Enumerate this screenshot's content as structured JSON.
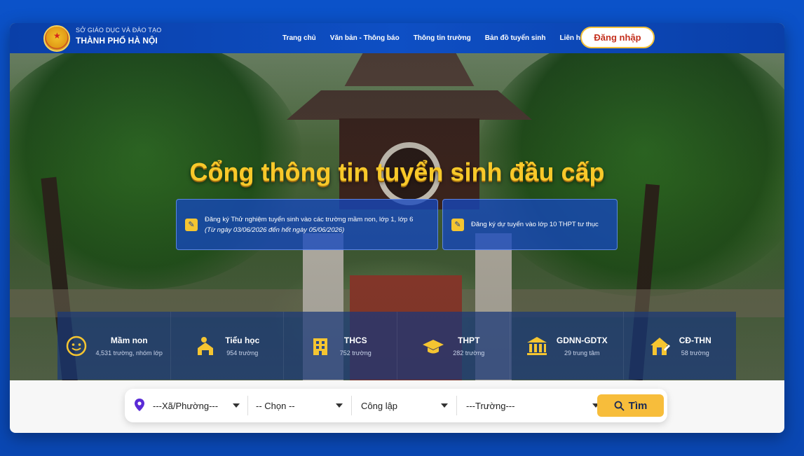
{
  "header": {
    "org_line1": "SỞ GIÁO DỤC VÀ ĐÀO TẠO",
    "org_line2": "THÀNH PHỐ HÀ NỘI",
    "nav": [
      "Trang chủ",
      "Văn bản - Thông báo",
      "Thông tin trường",
      "Bản đồ tuyển sinh",
      "Liên hệ"
    ],
    "login_label": "Đăng nhập"
  },
  "hero": {
    "title": "Cổng thông tin tuyển sinh đầu cấp"
  },
  "registration": [
    {
      "line1": "Đăng ký Thử nghiệm tuyển sinh vào các trường mầm non, lớp 1, lớp 6",
      "line2": "(Từ ngày 03/06/2026 đến hết ngày 05/06/2026)"
    },
    {
      "line1": "Đăng ký dự tuyển vào lớp 10 THPT tư thục",
      "line2": ""
    }
  ],
  "levels": [
    {
      "name": "Mầm non",
      "count": "4,531 trường, nhóm lớp",
      "icon": "face-icon"
    },
    {
      "name": "Tiểu học",
      "count": "954 trường",
      "icon": "child-school-icon"
    },
    {
      "name": "THCS",
      "count": "752 trường",
      "icon": "building-icon"
    },
    {
      "name": "THPT",
      "count": "282 trường",
      "icon": "graduation-cap-icon"
    },
    {
      "name": "GDNN-GDTX",
      "count": "29 trung tâm",
      "icon": "institution-icon"
    },
    {
      "name": "CĐ-THN",
      "count": "58 trường",
      "icon": "house-edit-icon"
    }
  ],
  "search": {
    "ward": "---Xã/Phường---",
    "choose": "-- Chọn --",
    "type": "Công lập",
    "school": "---Trường---",
    "find_label": "Tìm"
  },
  "colors": {
    "accent_yellow": "#f7bd3b",
    "header_blue": "#0e4fc4",
    "title_yellow": "#f8c92a"
  }
}
